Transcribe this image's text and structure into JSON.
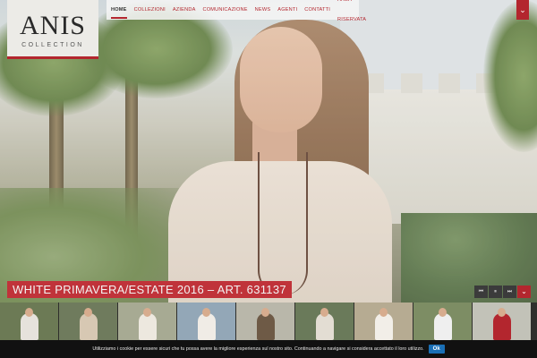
{
  "logo": {
    "brand": "ANIS",
    "subtitle": "COLLECTION"
  },
  "nav": {
    "items": [
      {
        "label": "HOME",
        "active": true
      },
      {
        "label": "COLLEZIONI",
        "active": false
      },
      {
        "label": "AZIENDA",
        "active": false
      },
      {
        "label": "COMUNICAZIONE",
        "active": false
      },
      {
        "label": "NEWS",
        "active": false
      },
      {
        "label": "AGENTI",
        "active": false
      },
      {
        "label": "CONTATTI",
        "active": false
      },
      {
        "label": "AREA RISERVATA",
        "active": false
      }
    ]
  },
  "top_toggle": {
    "icon": "chevron-down-icon",
    "glyph": "⌄"
  },
  "slide": {
    "caption": "WHITE PRIMAVERA/ESTATE 2016 – ART. 631137"
  },
  "controls": {
    "prev_glyph": "⏮",
    "pause_glyph": "⏸",
    "next_glyph": "⏭",
    "collapse_glyph": "⌄"
  },
  "thumbnails": [
    {
      "bg": "#6c7a55",
      "dress": "#e6e2dc"
    },
    {
      "bg": "#6f7b5d",
      "dress": "#d7c8b3"
    },
    {
      "bg": "#a7aa93",
      "dress": "#ede8df"
    },
    {
      "bg": "#93a7b7",
      "dress": "#f0ece6"
    },
    {
      "bg": "#b9b7aa",
      "dress": "#6e5a46"
    },
    {
      "bg": "#6a7a5a",
      "dress": "#e3ddd3"
    },
    {
      "bg": "#b6ab92",
      "dress": "#f2eee8"
    },
    {
      "bg": "#7d8d64",
      "dress": "#efefef"
    },
    {
      "bg": "#c2c2b8",
      "dress": "#b3262e"
    }
  ],
  "cookie": {
    "text": "Utilizziamo i cookie per essere sicuri che tu possa avere la migliore esperienza sul nostro sito. Continuando a navigare si considera accettato il loro utilizzo.",
    "button": "Ok"
  },
  "colors": {
    "accent": "#b3262e",
    "cookie_button": "#1a6fb5"
  }
}
